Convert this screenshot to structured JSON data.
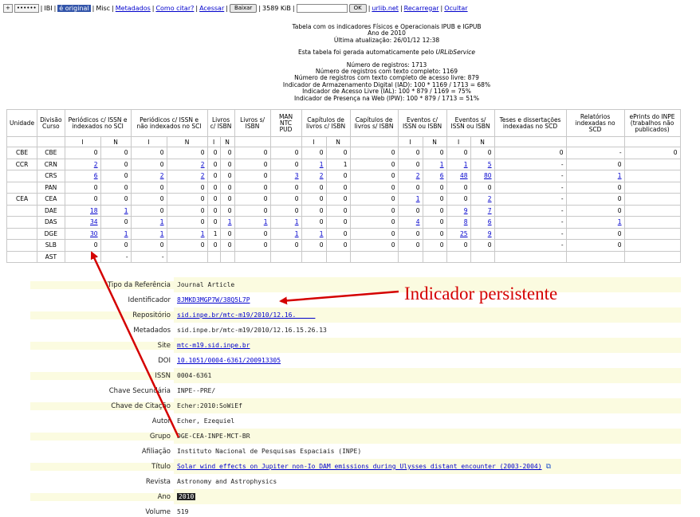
{
  "toolbar": {
    "plus": "+",
    "password": "••••••",
    "ibi": "IBI",
    "original": "é original",
    "misc": "Misc",
    "metadados": "Metadados",
    "como_citar": "Como citar?",
    "acessar": "Acessar",
    "baixar": "Baixar",
    "size": "3589 KiB",
    "ok": "OK",
    "urlib": "urlib.net",
    "recarregar": "Recarregar",
    "ocultar": "Ocultar"
  },
  "header": {
    "line1": "Tabela com os indicadores Físicos e Operacionais IPUB e IGPUB",
    "line2": "Ano de 2010",
    "line3": "Última atualização: 26/01/12 12:38",
    "line4a": "Esta tabela foi gerada automaticamente pelo",
    "line4b": "URLibService",
    "line5": "Número de registros: 1713",
    "line6": "Número de registros com texto completo: 1169",
    "line7": "Número de registros com texto completo de acesso livre: 879",
    "line8": "Indicador de Armazenamento Digital (IAD): 100 * 1169 / 1713 = 68%",
    "line9": "Indicador de Acesso Livre (IAL): 100 * 879 / 1169 = 75%",
    "line10": "Indicador de Presença na Web (IPW): 100 * 879 / 1713 = 51%"
  },
  "table": {
    "headers": [
      "Unidade",
      "Divisão Curso",
      "Periódicos c/ ISSN e indexados no SCI",
      "Periódicos c/ ISSN e não indexados no SCI",
      "Livros c/ ISBN",
      "Livros s/ ISBN",
      "MAN NTC PUD",
      "Capítulos de livros c/ ISBN",
      "Capítulos de livros s/ ISBN",
      "Eventos c/ ISSN ou ISBN",
      "Eventos s/ ISSN ou ISBN",
      "Teses e dissertações indexadas no SCD",
      "Relatórios indexadas no SCD",
      "ePrints do INPE (trabalhos não publicados)"
    ],
    "sub": [
      "I",
      "N",
      "I",
      "N",
      "I",
      "N",
      "I",
      "N",
      "I",
      "N",
      "I",
      "N"
    ],
    "rows": [
      {
        "u": "CBE",
        "d": "CBE",
        "v": [
          "0",
          "0",
          "0",
          "0",
          "0",
          "0",
          "0",
          "0",
          "0",
          "0",
          "0",
          "0",
          "0",
          "0",
          "0",
          "0",
          "-",
          "0"
        ]
      },
      {
        "u": "CCR",
        "d": "CRN",
        "v": [
          "2",
          "0",
          "0",
          "2",
          "0",
          "0",
          "0",
          "0",
          "1",
          "1",
          "0",
          "0",
          "1",
          "1",
          "5",
          "-",
          "0",
          ""
        ]
      },
      {
        "u": "",
        "d": "CRS",
        "v": [
          "6",
          "0",
          "2",
          "2",
          "0",
          "0",
          "0",
          "3",
          "2",
          "0",
          "0",
          "2",
          "6",
          "48",
          "80",
          "-",
          "1",
          ""
        ]
      },
      {
        "u": "",
        "d": "PAN",
        "v": [
          "0",
          "0",
          "0",
          "0",
          "0",
          "0",
          "0",
          "0",
          "0",
          "0",
          "0",
          "0",
          "0",
          "0",
          "0",
          "-",
          "0",
          ""
        ]
      },
      {
        "u": "CEA",
        "d": "CEA",
        "v": [
          "0",
          "0",
          "0",
          "0",
          "0",
          "0",
          "0",
          "0",
          "0",
          "0",
          "0",
          "1",
          "0",
          "0",
          "2",
          "-",
          "0",
          ""
        ]
      },
      {
        "u": "",
        "d": "DAE",
        "v": [
          "18",
          "1",
          "0",
          "0",
          "0",
          "0",
          "0",
          "0",
          "0",
          "0",
          "0",
          "0",
          "0",
          "9",
          "7",
          "-",
          "0",
          ""
        ]
      },
      {
        "u": "",
        "d": "DAS",
        "v": [
          "34",
          "0",
          "1",
          "0",
          "0",
          "1",
          "1",
          "1",
          "0",
          "0",
          "0",
          "4",
          "0",
          "8",
          "6",
          "-",
          "1",
          ""
        ]
      },
      {
        "u": "",
        "d": "DGE",
        "v": [
          "30",
          "1",
          "1",
          "1",
          "1",
          "0",
          "0",
          "1",
          "1",
          "0",
          "0",
          "0",
          "0",
          "25",
          "9",
          "-",
          "0",
          ""
        ]
      },
      {
        "u": "",
        "d": "SLB",
        "v": [
          "0",
          "0",
          "0",
          "0",
          "0",
          "0",
          "0",
          "0",
          "0",
          "0",
          "0",
          "0",
          "0",
          "0",
          "0",
          "-",
          "0",
          ""
        ]
      },
      {
        "u": "",
        "d": "AST",
        "v": [
          "-",
          "-",
          "-",
          "",
          "",
          "",
          "",
          "",
          "",
          "",
          "",
          "",
          "",
          "",
          "",
          "",
          "",
          ""
        ]
      }
    ]
  },
  "meta": [
    {
      "label": "Tipo da Referência",
      "value": "Journal Article"
    },
    {
      "label": "Identificador",
      "value": "8JMKD3MGP7W/38Q5L7P",
      "link": true
    },
    {
      "label": "Repositório",
      "value": "sid.inpe.br/mtc-m19/2010/12.16._____",
      "link": true
    },
    {
      "label": "Metadados",
      "value": "sid.inpe.br/mtc-m19/2010/12.16.15.26.13"
    },
    {
      "label": "Site",
      "value": "mtc-m19.sid.inpe.br",
      "link": true
    },
    {
      "label": "DOI",
      "value": "10.1051/0004-6361/200913305",
      "link": true
    },
    {
      "label": "ISSN",
      "value": "0004-6361"
    },
    {
      "label": "Chave Secundária",
      "value": "INPE--PRE/"
    },
    {
      "label": "Chave de Citação",
      "value": "Echer:2010:SoWiEf"
    },
    {
      "label": "Autor",
      "value": "Echer, Ezequiel"
    },
    {
      "label": "Grupo",
      "value": "DGE-CEA-INPE-MCT-BR"
    },
    {
      "label": "Afiliação",
      "value": "Instituto Nacional de Pesquisas Espaciais (INPE)"
    },
    {
      "label": "Título",
      "value": "Solar wind effects on Jupiter non-Io DAM emissions during Ulysses distant encounter (2003-2004)",
      "link": true,
      "ext": true
    },
    {
      "label": "Revista",
      "value": "Astronomy and Astrophysics"
    },
    {
      "label": "Ano",
      "value": "2010",
      "dark": true
    },
    {
      "label": "Volume",
      "value": "519"
    }
  ],
  "annotation": {
    "text": "Indicador persistente",
    "color": "#d40000"
  }
}
